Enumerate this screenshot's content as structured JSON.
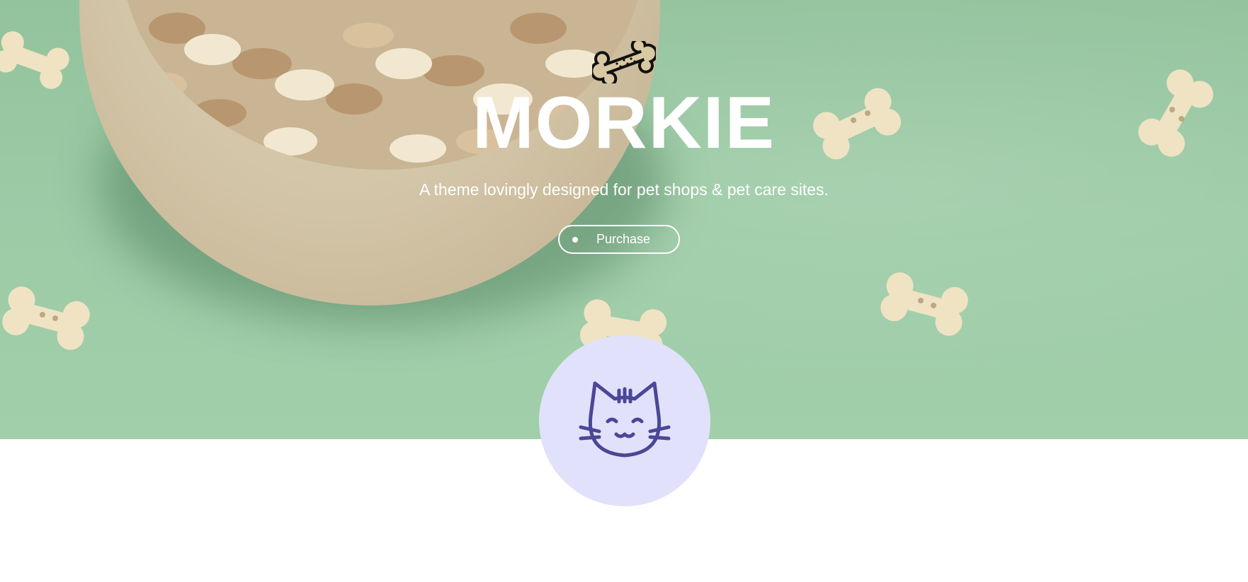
{
  "hero": {
    "title": "MORKIE",
    "subtitle": "A theme lovingly designed for pet shops & pet care sites.",
    "purchase_label": "Purchase",
    "logo_icon": "dog-bone-icon",
    "background_color": "#9ccaa4"
  },
  "feature": {
    "icon": "cat-face-icon",
    "circle_color": "#e1e1fb",
    "icon_color": "#4b4797"
  }
}
